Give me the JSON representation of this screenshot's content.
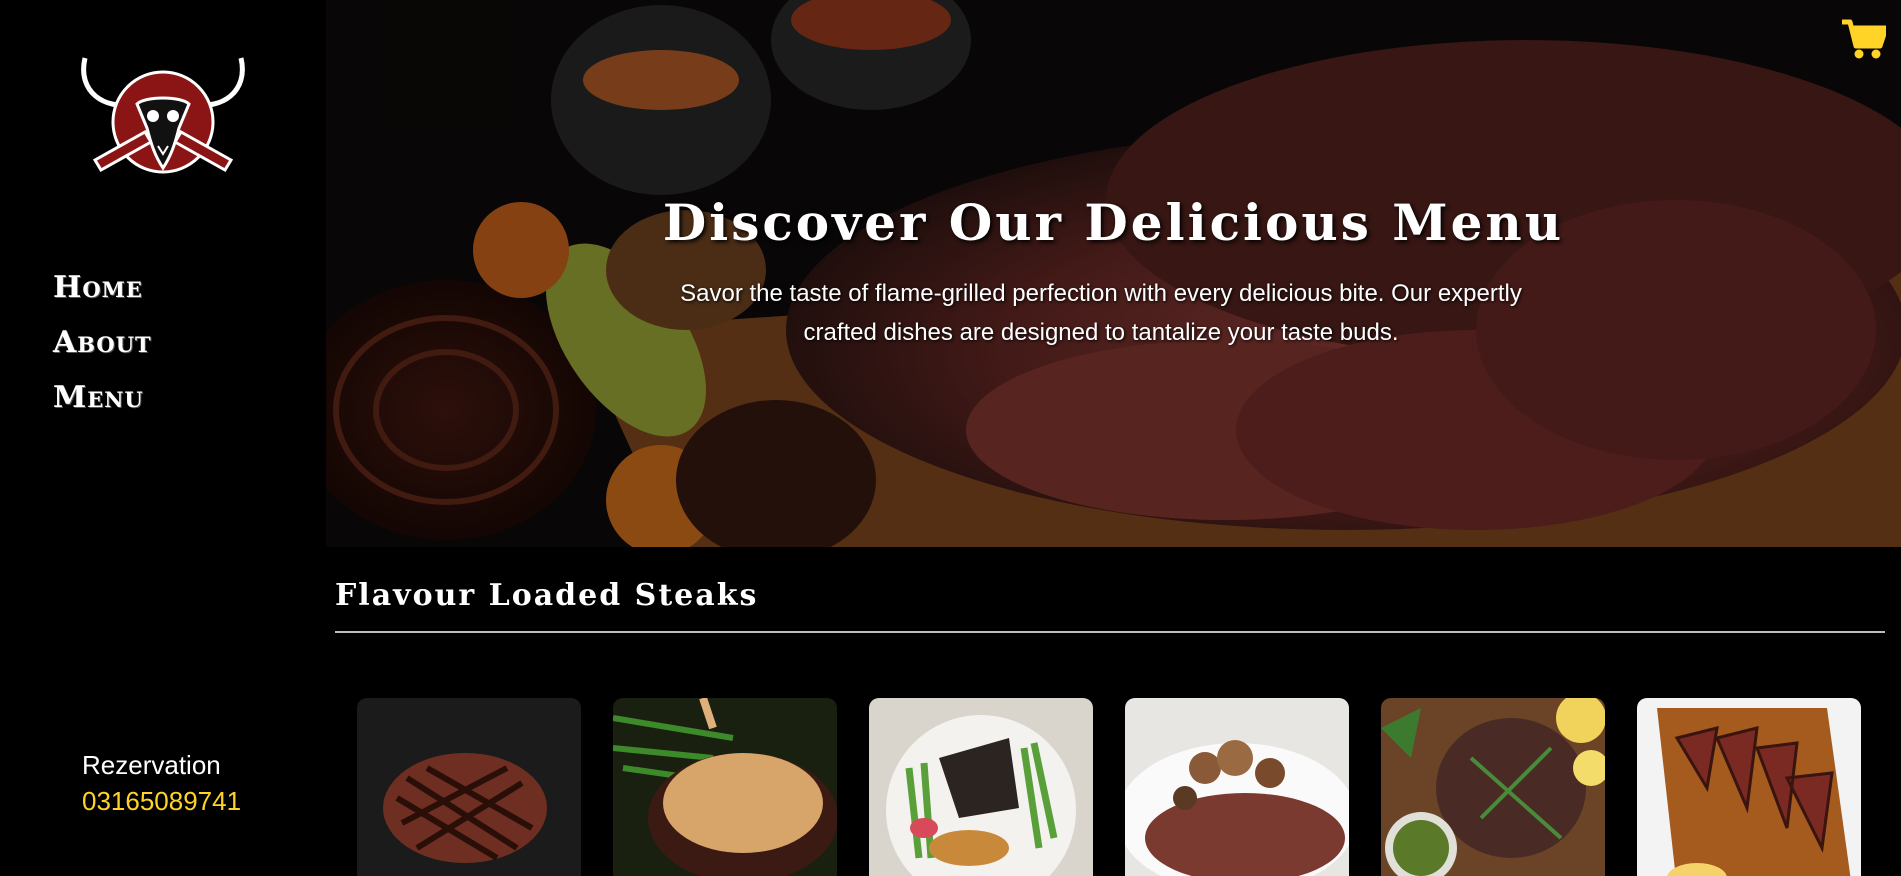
{
  "sidebar": {
    "logo": "bull-skull-logo",
    "nav": [
      {
        "label": "Home"
      },
      {
        "label": "About"
      },
      {
        "label": "Menu"
      }
    ],
    "reservation": {
      "label": "Rezervation",
      "phone": "03165089741"
    }
  },
  "hero": {
    "title": "Discover Our Delicious Menu",
    "description": "Savor the taste of flame-grilled perfection with every delicious bite. Our expertly crafted dishes are designed to tantalize your taste buds."
  },
  "header": {
    "cart_icon": "shopping-cart-icon",
    "cart_color": "#ffd426"
  },
  "section": {
    "title": "Flavour Loaded Steaks",
    "cards": [
      {
        "image": "grilled-steak"
      },
      {
        "image": "steak-with-sauce"
      },
      {
        "image": "seared-fish-plate"
      },
      {
        "image": "steak-with-mushrooms"
      },
      {
        "image": "herb-steak-with-lemon"
      },
      {
        "image": "sliced-steak-board"
      }
    ]
  },
  "colors": {
    "accent": "#ffd426",
    "background": "#000000",
    "logo_red": "#8b1414"
  }
}
